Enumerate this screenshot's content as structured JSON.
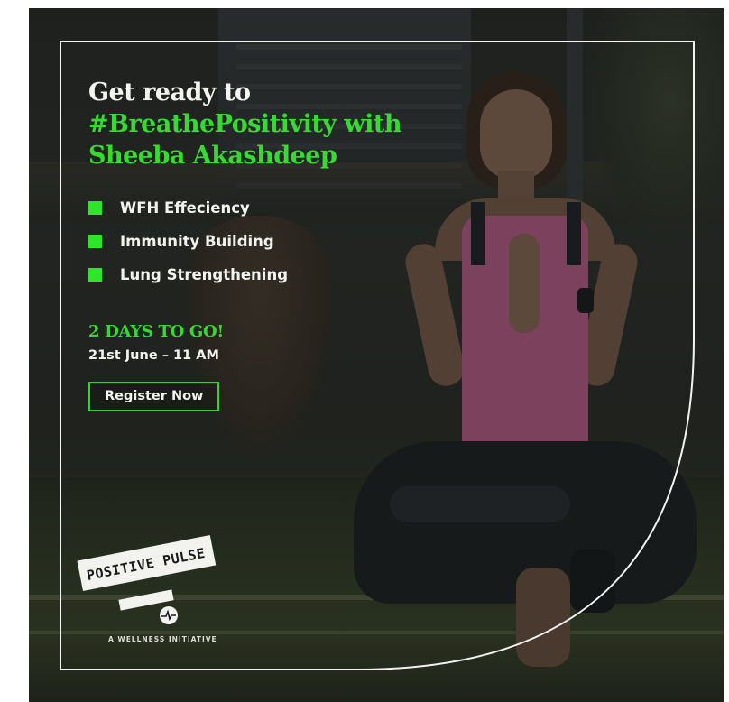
{
  "headline": {
    "line1": "Get ready to",
    "line2": "#BreathePositivity with",
    "line3": "Sheeba Akashdeep"
  },
  "features": [
    {
      "label": "WFH Effeciency"
    },
    {
      "label": "Immunity Building"
    },
    {
      "label": "Lung Strengthening"
    }
  ],
  "countdown": "2 DAYS TO GO!",
  "date": "21st June – 11 AM",
  "cta": {
    "label": "Register Now"
  },
  "logo": {
    "text": "POSITIVE PULSE",
    "tagline": "A WELLNESS INITIATIVE",
    "icon": "heartbeat-icon"
  },
  "colors": {
    "accent_green": "#38d933",
    "text_white": "#f4f4f1",
    "frame_white": "#f2f2ee"
  }
}
